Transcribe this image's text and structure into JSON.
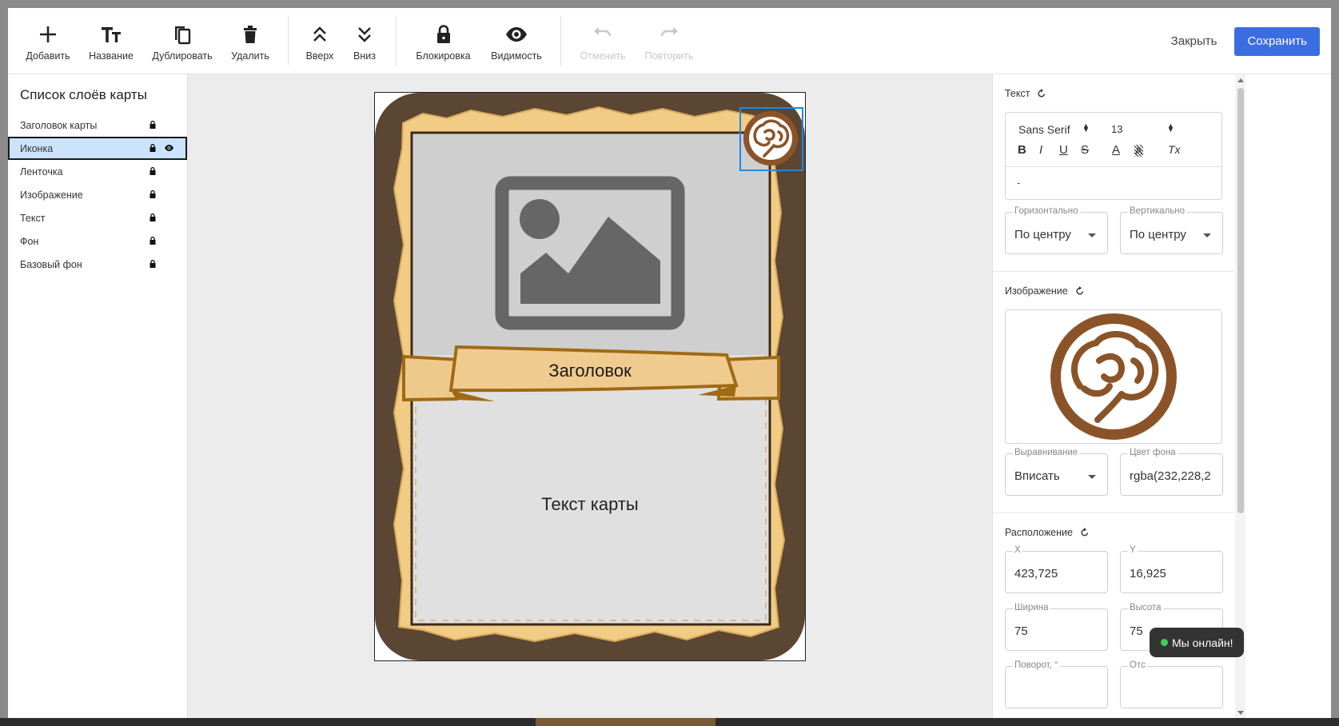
{
  "toolbar": {
    "add": "Добавить",
    "title": "Название",
    "duplicate": "Дублировать",
    "delete": "Удалить",
    "up": "Вверх",
    "down": "Вниз",
    "lock": "Блокировка",
    "visibility": "Видимость",
    "undo": "Отменить",
    "redo": "Повторить",
    "close": "Закрыть",
    "save": "Сохранить"
  },
  "layers": {
    "title": "Список слоёв карты",
    "items": [
      {
        "label": "Заголовок карты",
        "selected": false
      },
      {
        "label": "Иконка",
        "selected": true
      },
      {
        "label": "Ленточка",
        "selected": false
      },
      {
        "label": "Изображение",
        "selected": false
      },
      {
        "label": "Текст",
        "selected": false
      },
      {
        "label": "Фон",
        "selected": false
      },
      {
        "label": "Базовый фон",
        "selected": false
      }
    ]
  },
  "card": {
    "ribbon_title": "Заголовок",
    "body_text": "Текст карты",
    "icon": "brain-icon"
  },
  "text_section": {
    "title": "Текст",
    "font": "Sans Serif",
    "size": "13",
    "format_buttons": [
      "B",
      "I",
      "U",
      "S",
      "A",
      "A",
      "Tx"
    ],
    "content": "-",
    "horizontal_label": "Горизонтально",
    "horizontal_value": "По центру",
    "vertical_label": "Вертикально",
    "vertical_value": "По центру"
  },
  "image_section": {
    "title": "Изображение",
    "align_label": "Выравнивание",
    "align_value": "Вписать",
    "bg_label": "Цвет фона",
    "bg_value": "rgba(232,228,2"
  },
  "position_section": {
    "title": "Расположение",
    "x_label": "X",
    "x_value": "423,725",
    "y_label": "Y",
    "y_value": "16,925",
    "width_label": "Ширина",
    "width_value": "75",
    "height_label": "Высота",
    "height_value": "75",
    "rotation_label": "Поворот, °",
    "other_label": "Отс"
  },
  "chat": {
    "label": "Мы онлайн!"
  },
  "colors": {
    "accent": "#3b6de2",
    "selection": "#1e88e5",
    "card_frame": "#5a4632",
    "parchment": "#f2cc85",
    "brain": "#8b5428"
  }
}
